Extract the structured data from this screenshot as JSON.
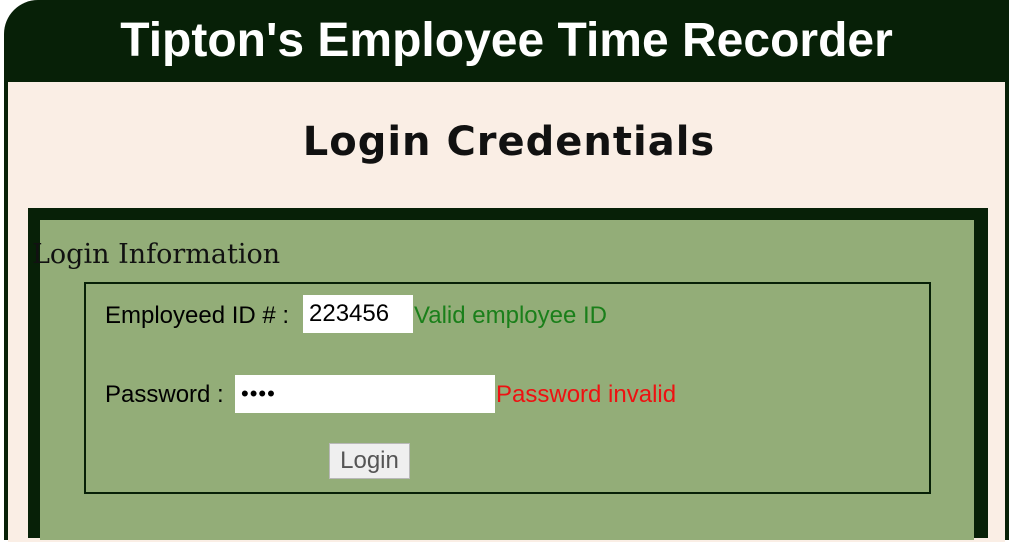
{
  "app": {
    "title": "Tipton's Employee Time Recorder"
  },
  "page": {
    "title": "Login Credentials"
  },
  "login": {
    "section_heading": "Login Information",
    "employee_id_label": "Employeed ID # :",
    "employee_id_value": "223456",
    "employee_id_status": "Valid employee ID",
    "password_label": "Password :",
    "password_value": "••••",
    "password_status": "Password invalid",
    "submit_label": "Login"
  },
  "colors": {
    "frame": "#072007",
    "body_background": "#faeee5",
    "panel_background": "#93ad78",
    "valid_status": "#1a7f1a",
    "invalid_status": "#ee1111"
  }
}
